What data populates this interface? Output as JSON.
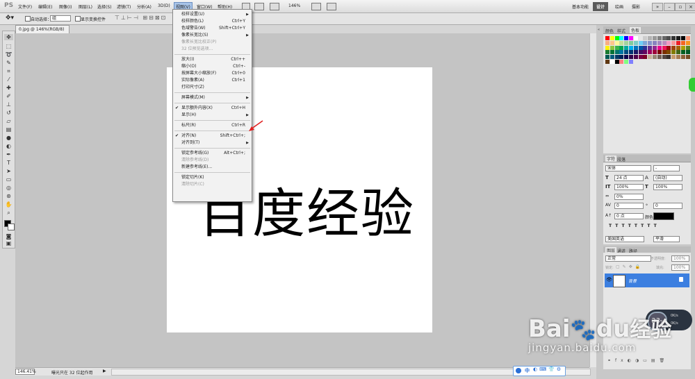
{
  "menubar": {
    "logo": "PS",
    "items": [
      "文件(F)",
      "编辑(E)",
      "图像(I)",
      "图层(L)",
      "选择(S)",
      "滤镜(T)",
      "分析(A)",
      "3D(D)",
      "视图(V)",
      "窗口(W)",
      "帮助(H)"
    ],
    "zoom": "146%",
    "workspaces": [
      "基本功能",
      "设计",
      "绘画",
      "摄影"
    ]
  },
  "options": {
    "auto_select_label": "自动选择：",
    "auto_select_value": "组",
    "transform_label": "显示变换控件"
  },
  "doc_tab": "0.jpg @ 146%(RGB/8)",
  "canvas_text": "百度经验",
  "status": {
    "zoom": "146.41%",
    "info": "曝光只在 32 位起作用"
  },
  "view_menu": [
    {
      "label": "校样设置(U)",
      "sub": true
    },
    {
      "label": "校样颜色(L)",
      "sc": "Ctrl+Y"
    },
    {
      "label": "色域警告(W)",
      "sc": "Shift+Ctrl+Y"
    },
    {
      "label": "像素长宽比(S)",
      "sub": true
    },
    {
      "label": "像素长宽比校正(P)",
      "dis": true
    },
    {
      "label": "32 位预览选项...",
      "dis": true
    },
    {
      "sep": true
    },
    {
      "label": "放大(I)",
      "sc": "Ctrl++"
    },
    {
      "label": "缩小(O)",
      "sc": "Ctrl+-"
    },
    {
      "label": "按屏幕大小缩放(F)",
      "sc": "Ctrl+0"
    },
    {
      "label": "实际像素(A)",
      "sc": "Ctrl+1"
    },
    {
      "label": "打印尺寸(Z)"
    },
    {
      "sep": true
    },
    {
      "label": "屏幕模式(M)",
      "sub": true
    },
    {
      "sep": true
    },
    {
      "label": "显示额外内容(X)",
      "sc": "Ctrl+H",
      "ck": true
    },
    {
      "label": "显示(H)",
      "sub": true
    },
    {
      "sep": true
    },
    {
      "label": "标尺(R)",
      "sc": "Ctrl+R"
    },
    {
      "sep": true
    },
    {
      "label": "对齐(N)",
      "sc": "Shift+Ctrl+;",
      "ck": true
    },
    {
      "label": "对齐到(T)",
      "sub": true
    },
    {
      "sep": true
    },
    {
      "label": "锁定参考线(G)",
      "sc": "Alt+Ctrl+;"
    },
    {
      "label": "清除参考线(D)",
      "dis": true
    },
    {
      "label": "新建参考线(E)..."
    },
    {
      "sep": true
    },
    {
      "label": "锁定切片(K)"
    },
    {
      "label": "清除切片(C)",
      "dis": true
    }
  ],
  "panels": {
    "swatch_tabs": [
      "颜色",
      "样式",
      "色板"
    ],
    "char_tabs": [
      "字符",
      "段落"
    ],
    "font": "宋体",
    "font_style": "-",
    "size": "24 点",
    "leading": "(自动)",
    "vscale": "100%",
    "hscale": "100%",
    "tracking": "0%",
    "kerning": "0",
    "baseline": "0 点",
    "color_label": "颜色:",
    "language": "美国英语",
    "aa": "平滑",
    "layer_tabs": [
      "图层",
      "通道",
      "路径"
    ],
    "blend": "正常",
    "opacity_label": "不透明度:",
    "opacity": "100%",
    "lock_label": "锁定:",
    "fill_label": "填充:",
    "fill": "100%",
    "layer_name": "背景"
  },
  "net_widget": {
    "percent": "33",
    "unit": "%",
    "up": "0K/s",
    "down": "0K/s"
  },
  "ime": "中",
  "watermark": {
    "brand": "Bai",
    "brand2": "du",
    "cn": "经验",
    "url": "jingyan.baidu.com"
  },
  "colors": {
    "accent": "#3c7fe0",
    "workspace_sel": "#5a5a5a",
    "arrow": "#e02020"
  },
  "swatch_colors": [
    "#ff0000",
    "#ffff00",
    "#00ff00",
    "#00ffff",
    "#0000ff",
    "#ff00ff",
    "#ffffff",
    "#e6e6e6",
    "#cccccc",
    "#b3b3b3",
    "#999999",
    "#808080",
    "#666666",
    "#4d4d4d",
    "#333333",
    "#1a1a1a",
    "#000000",
    "#f7977a",
    "#f9ad81",
    "#fdc68a",
    "#fff79a",
    "#c4df9b",
    "#a2d39c",
    "#82ca9d",
    "#7bcdc8",
    "#6ecff6",
    "#7ea7d8",
    "#8493ca",
    "#8882be",
    "#a187be",
    "#bc8dbf",
    "#f49ac2",
    "#f6989d",
    "#ed1c24",
    "#f26522",
    "#f7941d",
    "#fff200",
    "#8dc63f",
    "#39b54a",
    "#00a651",
    "#00a99d",
    "#00aeef",
    "#0072bc",
    "#0054a6",
    "#2e3192",
    "#662d91",
    "#92278f",
    "#ec008c",
    "#ed145b",
    "#9e0b0f",
    "#a0410d",
    "#a3620a",
    "#aba000",
    "#598527",
    "#1a7b30",
    "#007236",
    "#00746b",
    "#0076a3",
    "#004b80",
    "#003471",
    "#1b1464",
    "#440e62",
    "#630460",
    "#9e005d",
    "#9e0039",
    "#790000",
    "#7b2e00",
    "#7d4900",
    "#827b00",
    "#406618",
    "#005e20",
    "#005826",
    "#005952",
    "#005b7f",
    "#003663",
    "#002157",
    "#0d004c",
    "#32004b",
    "#4b0049",
    "#7b0046",
    "#7a0026",
    "#c7b299",
    "#998675",
    "#736357",
    "#534741",
    "#37302d",
    "#c69c6d",
    "#a67c52",
    "#8c6239",
    "#754c24",
    "#603913",
    "#ffffff",
    "#000000",
    "#ff8080",
    "#80ff80",
    "#8080ff"
  ]
}
